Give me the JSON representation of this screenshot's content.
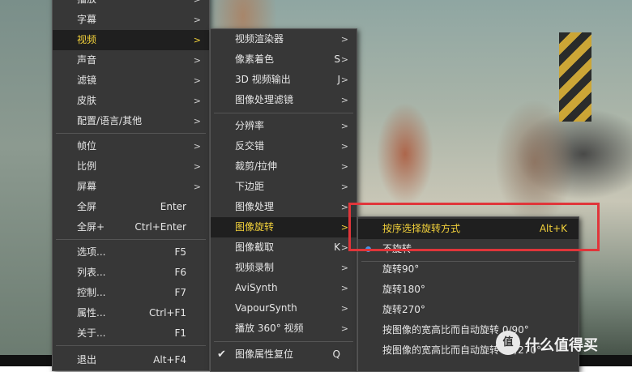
{
  "menu1": {
    "items": [
      {
        "label": "播放",
        "shortcut": "",
        "arrow": ">"
      },
      {
        "label": "字幕",
        "shortcut": "",
        "arrow": ">"
      },
      {
        "label": "视频",
        "shortcut": "",
        "arrow": ">"
      },
      {
        "label": "声音",
        "shortcut": "",
        "arrow": ">"
      },
      {
        "label": "滤镜",
        "shortcut": "",
        "arrow": ">"
      },
      {
        "label": "皮肤",
        "shortcut": "",
        "arrow": ">"
      },
      {
        "label": "配置/语言/其他",
        "shortcut": "",
        "arrow": ">"
      },
      {
        "label": "帧位",
        "shortcut": "",
        "arrow": ">"
      },
      {
        "label": "比例",
        "shortcut": "",
        "arrow": ">"
      },
      {
        "label": "屏幕",
        "shortcut": "",
        "arrow": ">"
      },
      {
        "label": "全屏",
        "shortcut": "Enter",
        "arrow": ""
      },
      {
        "label": "全屏+",
        "shortcut": "Ctrl+Enter",
        "arrow": ""
      },
      {
        "label": "选项...",
        "shortcut": "F5",
        "arrow": ""
      },
      {
        "label": "列表...",
        "shortcut": "F6",
        "arrow": ""
      },
      {
        "label": "控制...",
        "shortcut": "F7",
        "arrow": ""
      },
      {
        "label": "属性...",
        "shortcut": "Ctrl+F1",
        "arrow": ""
      },
      {
        "label": "关于...",
        "shortcut": "F1",
        "arrow": ""
      },
      {
        "label": "退出",
        "shortcut": "Alt+F4",
        "arrow": ""
      }
    ]
  },
  "menu2": {
    "items": [
      {
        "label": "视频渲染器",
        "shortcut": "",
        "arrow": ">"
      },
      {
        "label": "像素着色",
        "shortcut": "S",
        "arrow": ">"
      },
      {
        "label": "3D 视频输出",
        "shortcut": "J",
        "arrow": ">"
      },
      {
        "label": "图像处理滤镜",
        "shortcut": "",
        "arrow": ">"
      },
      {
        "label": "分辨率",
        "shortcut": "",
        "arrow": ">"
      },
      {
        "label": "反交错",
        "shortcut": "",
        "arrow": ">"
      },
      {
        "label": "裁剪/拉伸",
        "shortcut": "",
        "arrow": ">"
      },
      {
        "label": "下边距",
        "shortcut": "",
        "arrow": ">"
      },
      {
        "label": "图像处理",
        "shortcut": "",
        "arrow": ">"
      },
      {
        "label": "图像旋转",
        "shortcut": "",
        "arrow": ">"
      },
      {
        "label": "图像截取",
        "shortcut": "K",
        "arrow": ">"
      },
      {
        "label": "视频录制",
        "shortcut": "",
        "arrow": ">"
      },
      {
        "label": "AviSynth",
        "shortcut": "",
        "arrow": ">"
      },
      {
        "label": "VapourSynth",
        "shortcut": "",
        "arrow": ">"
      },
      {
        "label": "播放 360° 视频",
        "shortcut": "",
        "arrow": ">"
      },
      {
        "label": "图像属性复位",
        "shortcut": "Q",
        "arrow": ""
      }
    ]
  },
  "menu3": {
    "items": [
      {
        "label": "按序选择旋转方式",
        "shortcut": "Alt+K"
      },
      {
        "label": "不旋转",
        "shortcut": ""
      },
      {
        "label": "旋转90°",
        "shortcut": ""
      },
      {
        "label": "旋转180°",
        "shortcut": ""
      },
      {
        "label": "旋转270°",
        "shortcut": ""
      },
      {
        "label": "按图像的宽高比而自动旋转 0/90°",
        "shortcut": ""
      },
      {
        "label": "按图像的宽高比而自动旋转 90/270°",
        "shortcut": ""
      }
    ]
  },
  "watermark": {
    "badge": "值",
    "text": "什么值得买"
  },
  "colors": {
    "highlight": "#f3d23b",
    "menu_bg": "#373737",
    "selected_bg": "#1f1f1f",
    "annotation": "#e0353a",
    "radio": "#4a90e2"
  }
}
